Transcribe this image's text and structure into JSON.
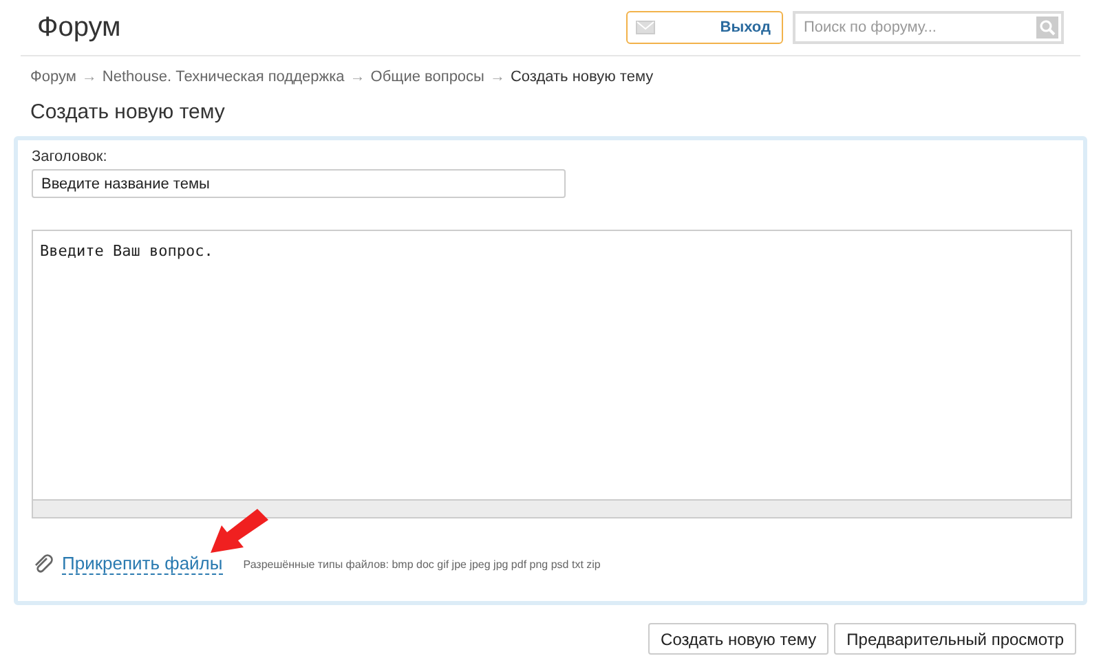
{
  "header": {
    "title": "Форум",
    "logout_button": "Выход",
    "search": {
      "placeholder": "Поиск по форуму..."
    }
  },
  "breadcrumbs": {
    "separator": "→",
    "items": [
      {
        "label": "Форум",
        "current": false
      },
      {
        "label": "Nethouse. Техническая поддержка",
        "current": false
      },
      {
        "label": "Общие вопросы",
        "current": false
      },
      {
        "label": "Создать новую тему",
        "current": true
      }
    ]
  },
  "page_title": "Создать новую тему",
  "form": {
    "subject_label": "Заголовок:",
    "subject_value": "Введите название темы",
    "message_value": "Введите Ваш вопрос.",
    "attach_link": "Прикрепить файлы",
    "allowed_types": "Разрешённые типы файлов: bmp doc gif jpe jpeg jpg pdf png psd txt zip"
  },
  "buttons": [
    "Создать новую тему",
    "Предварительный просмотр"
  ]
}
